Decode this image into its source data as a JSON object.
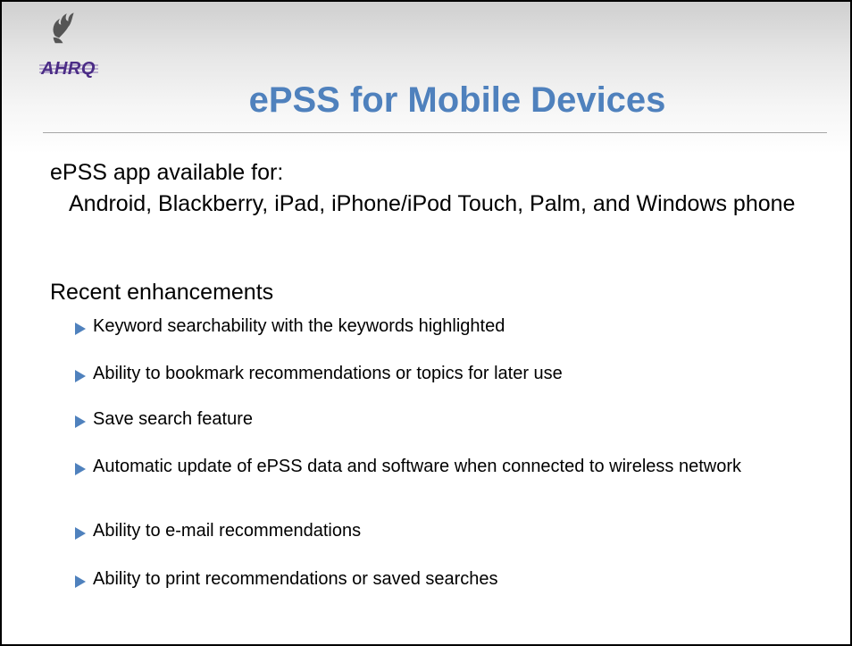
{
  "slide": {
    "logo_icon": "hhs-eagle-ahrq-logo",
    "logo_text": "AHRQ",
    "title": "ePSS for Mobile Devices",
    "title_color": "#4f81bd",
    "accent_color": "#4f81bd"
  },
  "sections": {
    "availability": {
      "heading": "ePSS app available for:",
      "text": "Android, Blackberry, iPad, iPhone/iPod Touch, Palm, and Windows phone"
    },
    "enhancements": {
      "heading": "Recent enhancements",
      "items": [
        "Keyword searchability with the keywords highlighted",
        "Ability to bookmark recommendations or topics for later use",
        "Save search feature",
        "Automatic update of ePSS data and software when connected to wireless network",
        "Ability to e-mail recommendations",
        "Ability to print recommendations or saved searches"
      ]
    }
  }
}
